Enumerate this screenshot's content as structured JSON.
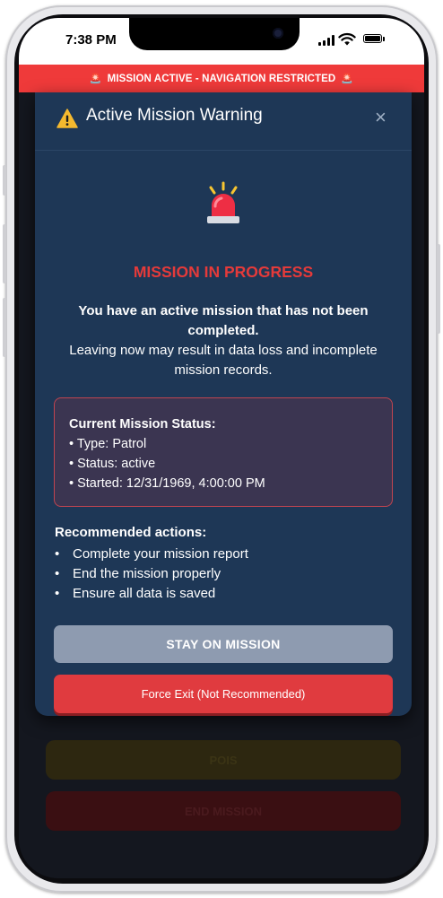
{
  "status_bar": {
    "time": "7:38 PM"
  },
  "banner": {
    "text": "MISSION ACTIVE - NAVIGATION RESTRICTED"
  },
  "modal": {
    "title": "Active Mission Warning",
    "close": "×",
    "headline": "MISSION IN PROGRESS",
    "message_bold": "You have an active mission that has not been completed.",
    "message": "Leaving now may result in data loss and incomplete mission records.",
    "status_box": {
      "title": "Current Mission Status:",
      "type": "• Type: Patrol",
      "status": "• Status: active",
      "started": "• Started: 12/31/1969, 4:00:00 PM"
    },
    "recommended": {
      "title": "Recommended actions:",
      "items": [
        "Complete your mission report",
        "End the mission properly",
        "Ensure all data is saved"
      ]
    },
    "stay_button": "STAY ON MISSION",
    "force_button": "Force Exit (Not Recommended)"
  },
  "background": {
    "pois_label": "POIS",
    "end_mission_label": "END MISSION"
  },
  "colors": {
    "banner": "#ef3a3a",
    "modal": "#1e3756",
    "headline": "#e53a3a",
    "stay_button": "#8e9bb0",
    "force_button": "#e03b3f"
  },
  "icons": [
    "siren-icon",
    "warning-icon",
    "close-icon",
    "signal-icon",
    "wifi-icon",
    "battery-icon"
  ]
}
